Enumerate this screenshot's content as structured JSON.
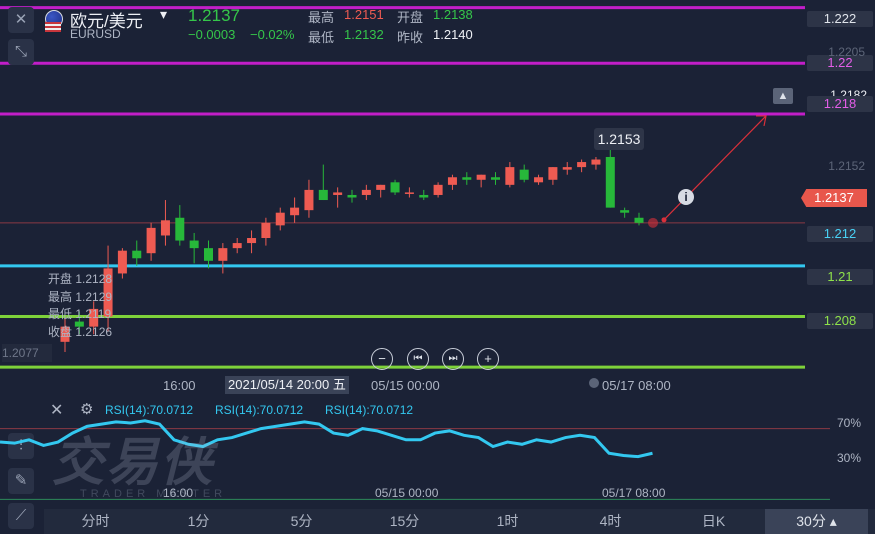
{
  "header": {
    "symbol_name": "欧元/美元",
    "symbol_code": "EURUSD",
    "last_price": "1.2137",
    "change": "−0.0003",
    "change_pct": "−0.02%",
    "high_label": "最高",
    "high_value": "1.2151",
    "open_label": "开盘",
    "open_value": "1.2138",
    "low_label": "最低",
    "low_value": "1.2132",
    "prev_close_label": "昨收",
    "prev_close_value": "1.2140",
    "dropdown_arrow": "▾"
  },
  "colors": {
    "background": "#1b2236",
    "up": "#ee5b52",
    "down": "#27b83a",
    "magenta_line": "#c21ec8",
    "cyan_line": "#33c8f0",
    "green_line": "#7ed23a",
    "rsi_line": "#33c8f0",
    "arrow": "#d9303a"
  },
  "chart_data": {
    "type": "candlestick",
    "candles": [
      {
        "o": 1.209,
        "h": 1.21,
        "l": 1.2086,
        "c": 1.2096
      },
      {
        "o": 1.2098,
        "h": 1.2102,
        "l": 1.2093,
        "c": 1.2096
      },
      {
        "o": 1.2096,
        "h": 1.2106,
        "l": 1.2093,
        "c": 1.2103
      },
      {
        "o": 1.21,
        "h": 1.2128,
        "l": 1.2094,
        "c": 1.2119
      },
      {
        "o": 1.2117,
        "h": 1.2127,
        "l": 1.2115,
        "c": 1.2126
      },
      {
        "o": 1.2126,
        "h": 1.213,
        "l": 1.212,
        "c": 1.2123
      },
      {
        "o": 1.2125,
        "h": 1.2137,
        "l": 1.2122,
        "c": 1.2135
      },
      {
        "o": 1.2132,
        "h": 1.2146,
        "l": 1.2128,
        "c": 1.2138
      },
      {
        "o": 1.2139,
        "h": 1.2144,
        "l": 1.2128,
        "c": 1.213
      },
      {
        "o": 1.213,
        "h": 1.2133,
        "l": 1.2121,
        "c": 1.2127
      },
      {
        "o": 1.2127,
        "h": 1.213,
        "l": 1.2119,
        "c": 1.2122
      },
      {
        "o": 1.2122,
        "h": 1.2129,
        "l": 1.2117,
        "c": 1.2127
      },
      {
        "o": 1.2127,
        "h": 1.2131,
        "l": 1.2125,
        "c": 1.2129
      },
      {
        "o": 1.2129,
        "h": 1.2134,
        "l": 1.2125,
        "c": 1.2131
      },
      {
        "o": 1.2131,
        "h": 1.2139,
        "l": 1.2128,
        "c": 1.2137
      },
      {
        "o": 1.2136,
        "h": 1.2143,
        "l": 1.2134,
        "c": 1.2141
      },
      {
        "o": 1.214,
        "h": 1.2147,
        "l": 1.2137,
        "c": 1.2143
      },
      {
        "o": 1.2142,
        "h": 1.2154,
        "l": 1.2139,
        "c": 1.215
      },
      {
        "o": 1.215,
        "h": 1.216,
        "l": 1.2146,
        "c": 1.2146
      },
      {
        "o": 1.2148,
        "h": 1.2151,
        "l": 1.2143,
        "c": 1.2149
      },
      {
        "o": 1.2148,
        "h": 1.215,
        "l": 1.2145,
        "c": 1.2147
      },
      {
        "o": 1.2148,
        "h": 1.2152,
        "l": 1.2146,
        "c": 1.215
      },
      {
        "o": 1.215,
        "h": 1.2152,
        "l": 1.2147,
        "c": 1.2152
      },
      {
        "o": 1.2153,
        "h": 1.2154,
        "l": 1.2148,
        "c": 1.2149
      },
      {
        "o": 1.2149,
        "h": 1.2151,
        "l": 1.2147,
        "c": 1.2149
      },
      {
        "o": 1.2148,
        "h": 1.215,
        "l": 1.2146,
        "c": 1.2147
      },
      {
        "o": 1.2148,
        "h": 1.2153,
        "l": 1.2147,
        "c": 1.2152
      },
      {
        "o": 1.2152,
        "h": 1.2156,
        "l": 1.215,
        "c": 1.2155
      },
      {
        "o": 1.2155,
        "h": 1.2157,
        "l": 1.2152,
        "c": 1.2154
      },
      {
        "o": 1.2154,
        "h": 1.2156,
        "l": 1.2151,
        "c": 1.2156
      },
      {
        "o": 1.2155,
        "h": 1.2157,
        "l": 1.2152,
        "c": 1.2154
      },
      {
        "o": 1.2152,
        "h": 1.2161,
        "l": 1.2151,
        "c": 1.2159
      },
      {
        "o": 1.2158,
        "h": 1.216,
        "l": 1.2153,
        "c": 1.2154
      },
      {
        "o": 1.2153,
        "h": 1.2156,
        "l": 1.2152,
        "c": 1.2155
      },
      {
        "o": 1.2154,
        "h": 1.2159,
        "l": 1.2152,
        "c": 1.2159
      },
      {
        "o": 1.2158,
        "h": 1.2161,
        "l": 1.2156,
        "c": 1.2159
      },
      {
        "o": 1.2159,
        "h": 1.2162,
        "l": 1.2157,
        "c": 1.2161
      },
      {
        "o": 1.216,
        "h": 1.2163,
        "l": 1.2158,
        "c": 1.2162
      },
      {
        "o": 1.2163,
        "h": 1.2166,
        "l": 1.2143,
        "c": 1.2143
      },
      {
        "o": 1.2142,
        "h": 1.2143,
        "l": 1.2139,
        "c": 1.2141
      },
      {
        "o": 1.2139,
        "h": 1.2141,
        "l": 1.2136,
        "c": 1.2137
      }
    ],
    "ylim": [
      1.2069,
      1.2225
    ],
    "axis_ticks": [
      "1.2205",
      "1.2152"
    ],
    "axis_ticks_values": [
      1.2205,
      1.2152
    ],
    "price_lines": [
      {
        "label": "1.222",
        "value": 1.2222,
        "color": "#c21ec8"
      },
      {
        "label": "1.22",
        "value": 1.22,
        "color": "#c21ec8"
      },
      {
        "label": "1.218",
        "value": 1.218,
        "color": "#c21ec8"
      },
      {
        "label": "1.212",
        "value": 1.212,
        "color": "#33c8f0"
      },
      {
        "label": "1.21",
        "value": 1.21,
        "color": "#7ed23a"
      },
      {
        "label": "1.208",
        "value": 1.208,
        "color": "#7ed23a"
      }
    ],
    "current_price": "1.2137",
    "current_price_value": 1.2137,
    "alert_price": "1.2182",
    "tooltip_price": "1.2153",
    "left_price_label": "1.2077",
    "x_labels": [
      "16:00",
      "05/15 00:00",
      "05/17 08:00"
    ],
    "crosshair_time": "2021/05/14 20:00 五",
    "ohlc_tooltip": {
      "open": "开盘 1.2128",
      "high": "最高 1.2129",
      "low": "最低 1.2119",
      "close": "收盘 1.2126"
    }
  },
  "rsi": {
    "labels": [
      "RSI(14):70.0712",
      "RSI(14):70.0712",
      "RSI(14):70.0712"
    ],
    "level_high": "70%",
    "level_low": "30%",
    "levels": [
      70,
      30
    ],
    "values": [
      58,
      57,
      60,
      55,
      58,
      66,
      72,
      74,
      76,
      75,
      77,
      74,
      60,
      56,
      54,
      60,
      62,
      66,
      70,
      72,
      74,
      76,
      74,
      66,
      64,
      70,
      68,
      64,
      60,
      60,
      66,
      68,
      64,
      62,
      54,
      58,
      56,
      60,
      58,
      62,
      64,
      62,
      48,
      46,
      45,
      48
    ],
    "x_labels": [
      "16:00",
      "05/15 00:00",
      "05/17 08:00"
    ]
  },
  "controls": {
    "zoom_out": "−",
    "step_back": "⏮",
    "step_forward": "⏭",
    "zoom_in": "+"
  },
  "watermark": {
    "name": "交易侠",
    "sub": "TRADER MASTER"
  },
  "timeframes": [
    "分时",
    "1分",
    "5分",
    "15分",
    "1时",
    "4时",
    "日K",
    "30分 ▴"
  ],
  "active_timeframe": 7
}
